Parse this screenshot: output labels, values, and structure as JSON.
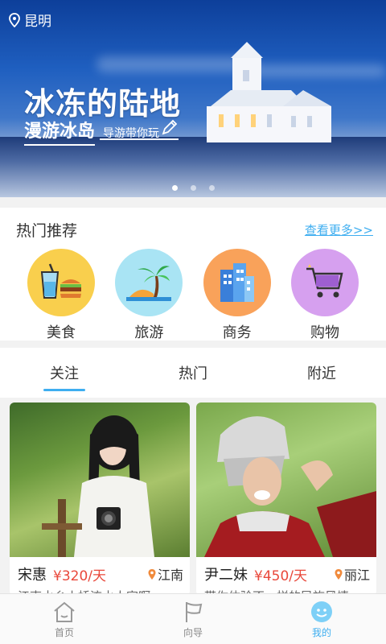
{
  "banner": {
    "location": "昆明",
    "title": "冰冻的陆地",
    "subtitle_main": "漫游冰岛",
    "subtitle_small": "导游带你玩",
    "slides": 3,
    "active_slide": 0
  },
  "hot": {
    "title": "热门推荐",
    "more": "查看更多>>",
    "categories": [
      {
        "label": "美食",
        "icon": "food-icon",
        "color": "#f9cf4d"
      },
      {
        "label": "旅游",
        "icon": "palm-tree-icon",
        "color": "#a9e4f4"
      },
      {
        "label": "商务",
        "icon": "buildings-icon",
        "color": "#f9a25a"
      },
      {
        "label": "购物",
        "icon": "cart-icon",
        "color": "#d6a0ef"
      }
    ]
  },
  "tabs": [
    {
      "label": "关注",
      "active": true
    },
    {
      "label": "热门",
      "active": false
    },
    {
      "label": "附近",
      "active": false
    }
  ],
  "cards": [
    {
      "name": "宋惠",
      "price": "¥320/天",
      "location": "江南",
      "desc": "江南水乡小桥流水人家啊"
    },
    {
      "name": "尹二妹",
      "price": "¥450/天",
      "location": "丽江",
      "desc": "带你体验不一样的民族风情"
    }
  ],
  "nav": [
    {
      "label": "首页",
      "icon": "home-icon",
      "active": false
    },
    {
      "label": "向导",
      "icon": "flag-icon",
      "active": false
    },
    {
      "label": "我的",
      "icon": "profile-icon",
      "active": true
    }
  ],
  "colors": {
    "accent": "#3eaef0",
    "price": "#e9483b"
  }
}
